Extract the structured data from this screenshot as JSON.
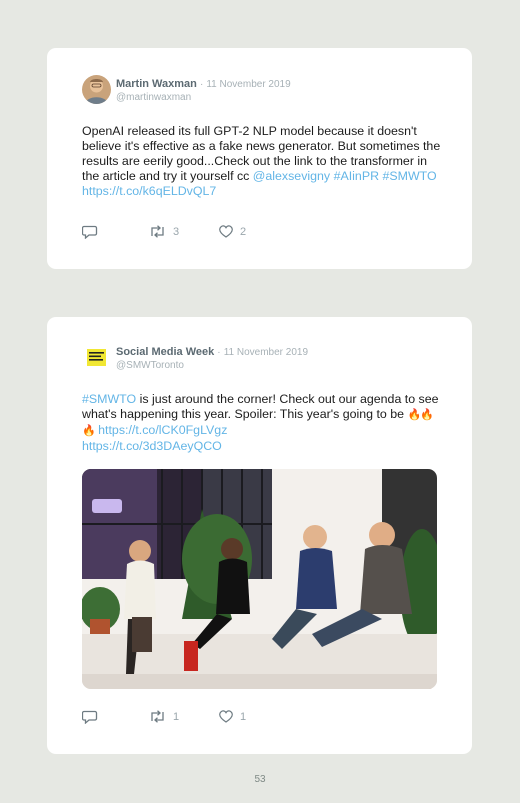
{
  "tweets": [
    {
      "author": "Martin Waxman",
      "date": "11 November 2019",
      "handle": "@martinwaxman",
      "text": "OpenAI released its full GPT-2 NLP model because it doesn't believe it's effective as a fake news generator. But sometimes the results are eerily good...Check out the link to the transformer in the article and try it yourself cc ",
      "links": [
        "@alexsevigny",
        "#AIinPR",
        "#SMWTO",
        "https://t.co/k6qELDvQL7"
      ],
      "retweets": "3",
      "likes": "2",
      "icons": {
        "avatar": "person-avatar-icon",
        "reply": "reply-icon",
        "retweet": "retweet-icon",
        "like": "heart-icon"
      }
    },
    {
      "author": "Social Media Week",
      "date": "11 November 2019",
      "handle": "@SMWToronto",
      "avatar_text": "SOCIAL MEDIA WEEK",
      "text_link1": "#SMWTO",
      "text_main": " is just around the corner! Check out our agenda to see what's happening this year. Spoiler: This year's going to be ",
      "emoji": "🔥🔥🔥",
      "text_link2": "https://t.co/lCK0FgLVgz",
      "text_link3": "https://t.co/3d3DAeyQCO",
      "retweets": "1",
      "likes": "1",
      "icons": {
        "avatar": "smw-logo-icon",
        "reply": "reply-icon",
        "retweet": "retweet-icon",
        "like": "heart-icon",
        "photo": "panel-photo"
      }
    }
  ],
  "page": {
    "number": "53"
  },
  "colors": {
    "background": "#e6e8e3",
    "card": "#ffffff",
    "link": "#63b5e6",
    "muted": "#a7b1b6"
  }
}
